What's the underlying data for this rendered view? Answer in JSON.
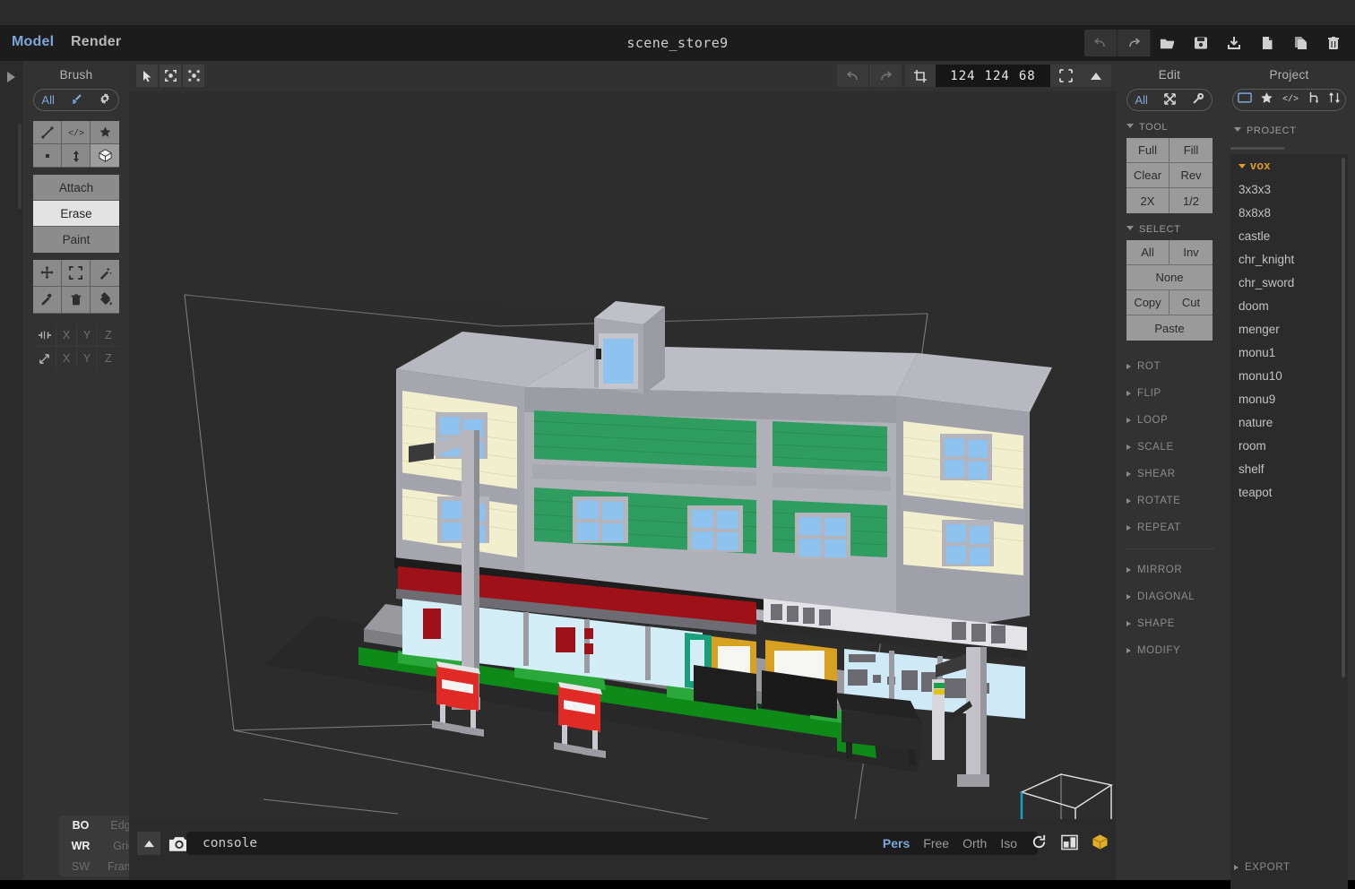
{
  "window": {
    "title": "scene_store9",
    "menus": [
      {
        "label": "Model",
        "active": true
      },
      {
        "label": "Render",
        "active": false
      }
    ],
    "tools": [
      {
        "name": "undo-icon",
        "label": "undo"
      },
      {
        "name": "redo-icon",
        "label": "redo"
      },
      {
        "name": "open-folder-icon",
        "label": "open"
      },
      {
        "name": "save-icon",
        "label": "save"
      },
      {
        "name": "import-icon",
        "label": "import"
      },
      {
        "name": "new-file-icon",
        "label": "new"
      },
      {
        "name": "copy-file-icon",
        "label": "copy"
      },
      {
        "name": "delete-icon",
        "label": "delete"
      }
    ]
  },
  "brush": {
    "title": "Brush",
    "pill": {
      "all_label": "All",
      "brush_icon": "brush-icon",
      "gear_icon": "gear-icon"
    },
    "shapes": [
      {
        "name": "line-brush-icon",
        "selected": false
      },
      {
        "name": "pattern-brush-icon",
        "selected": false
      },
      {
        "name": "star-brush-icon",
        "selected": false
      },
      {
        "name": "voxel-brush-icon",
        "selected": false
      },
      {
        "name": "center-brush-icon",
        "selected": false
      },
      {
        "name": "box-brush-icon",
        "selected": true
      }
    ],
    "modes": [
      {
        "label": "Attach",
        "active": false
      },
      {
        "label": "Erase",
        "active": true
      },
      {
        "label": "Paint",
        "active": false
      }
    ],
    "tools": [
      {
        "name": "move-icon"
      },
      {
        "name": "select-region-icon"
      },
      {
        "name": "magic-wand-icon"
      },
      {
        "name": "eyedropper-icon"
      },
      {
        "name": "trash-icon"
      },
      {
        "name": "paint-bucket-icon"
      }
    ],
    "axes": [
      {
        "name": "mirror-icon",
        "label": ""
      },
      {
        "label": "X"
      },
      {
        "label": "Y"
      },
      {
        "label": "Z"
      },
      {
        "name": "diagonal-icon",
        "label": ""
      },
      {
        "label": "X"
      },
      {
        "label": "Y"
      },
      {
        "label": "Z"
      }
    ]
  },
  "display_toggles": [
    {
      "label": "BO",
      "on": true
    },
    {
      "label": "Edge",
      "on": false
    },
    {
      "label": "WR",
      "on": true
    },
    {
      "label": "Grid",
      "on": false
    },
    {
      "label": "SW",
      "on": false
    },
    {
      "label": "Frame",
      "on": false
    }
  ],
  "viewport": {
    "left_tools": [
      {
        "name": "cursor-icon"
      },
      {
        "name": "marquee-select-icon"
      },
      {
        "name": "node-select-icon"
      }
    ],
    "undo_label": "undo",
    "redo_label": "redo",
    "crop_label": "crop",
    "dimensions": {
      "x": "124",
      "y": "124",
      "z": "68"
    },
    "fit_label": "fit",
    "collapse_label": "collapse"
  },
  "console": {
    "up_arrow": "expand-console-icon",
    "camera_icon": "camera-icon",
    "value": "console",
    "placeholder": "console"
  },
  "view_modes": [
    {
      "label": "Pers",
      "active": true
    },
    {
      "label": "Free",
      "active": false
    },
    {
      "label": "Orth",
      "active": false
    },
    {
      "label": "Iso",
      "active": false
    },
    {
      "name": "rotate-view-icon"
    },
    {
      "name": "layout-view-icon"
    },
    {
      "name": "voxel-cube-icon"
    }
  ],
  "edit": {
    "title": "Edit",
    "pill": {
      "all_label": "All",
      "transform_icon": "transform-icon",
      "wrench_icon": "wrench-icon"
    },
    "sections": {
      "tool": {
        "label": "TOOL",
        "buttons": [
          "Full",
          "Fill",
          "Clear",
          "Rev",
          "2X",
          "1/2"
        ]
      },
      "select": {
        "label": "SELECT",
        "buttons": [
          "All",
          "Inv",
          "None",
          "Copy",
          "Cut",
          "Paste"
        ]
      }
    },
    "collapsed_groups_a": [
      "ROT",
      "FLIP",
      "LOOP",
      "SCALE",
      "SHEAR",
      "ROTATE",
      "REPEAT"
    ],
    "collapsed_groups_b": [
      "MIRROR",
      "DIAGONAL",
      "SHAPE",
      "MODIFY"
    ]
  },
  "project": {
    "title": "Project",
    "pill": [
      {
        "name": "folder-icon"
      },
      {
        "name": "star-icon"
      },
      {
        "name": "code-icon"
      },
      {
        "name": "branch-icon"
      },
      {
        "name": "sort-icon"
      }
    ],
    "section_label": "PROJECT",
    "folder": "vox",
    "files": [
      "3x3x3",
      "8x8x8",
      "castle",
      "chr_knight",
      "chr_sword",
      "doom",
      "menger",
      "monu1",
      "monu10",
      "monu9",
      "nature",
      "room",
      "shelf",
      "teapot"
    ],
    "export_label": "EXPORT"
  },
  "colors": {
    "accent_blue": "#7ea6d8",
    "folder_orange": "#e2a020",
    "panel_bg": "#323232",
    "viewport_bg": "#2d2d2d",
    "titlebar_bg": "#1c1c1c"
  }
}
